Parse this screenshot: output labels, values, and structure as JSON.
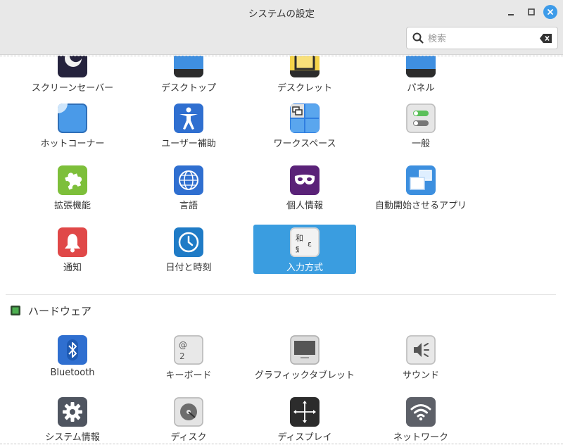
{
  "window": {
    "title": "システムの設定"
  },
  "search": {
    "placeholder": "検索",
    "value": ""
  },
  "sections": [
    {
      "name": "",
      "items": [
        {
          "label": "スクリーンセーバー",
          "icon": "screensaver-icon"
        },
        {
          "label": "デスクトップ",
          "icon": "desktop-icon"
        },
        {
          "label": "デスクレット",
          "icon": "desklet-icon"
        },
        {
          "label": "パネル",
          "icon": "panel-icon"
        },
        {
          "label": "ホットコーナー",
          "icon": "hot-corner-icon"
        },
        {
          "label": "ユーザー補助",
          "icon": "accessibility-icon"
        },
        {
          "label": "ワークスペース",
          "icon": "workspace-icon"
        },
        {
          "label": "一般",
          "icon": "general-toggle-icon"
        },
        {
          "label": "拡張機能",
          "icon": "puzzle-icon"
        },
        {
          "label": "言語",
          "icon": "language-globe-icon"
        },
        {
          "label": "個人情報",
          "icon": "mask-icon"
        },
        {
          "label": "自動開始させるアプリ",
          "icon": "startup-apps-icon"
        },
        {
          "label": "通知",
          "icon": "bell-icon"
        },
        {
          "label": "日付と時刻",
          "icon": "clock-icon"
        },
        {
          "label": "入力方式",
          "icon": "input-method-icon",
          "selected": true
        }
      ]
    },
    {
      "name": "ハードウェア",
      "icon": "chip-icon",
      "items": [
        {
          "label": "Bluetooth",
          "icon": "bluetooth-icon"
        },
        {
          "label": "キーボード",
          "icon": "keyboard-icon"
        },
        {
          "label": "グラフィックタブレット",
          "icon": "tablet-icon"
        },
        {
          "label": "サウンド",
          "icon": "speaker-icon"
        },
        {
          "label": "システム情報",
          "icon": "gear-icon"
        },
        {
          "label": "ディスク",
          "icon": "disk-icon"
        },
        {
          "label": "ディスプレイ",
          "icon": "display-icon"
        },
        {
          "label": "ネットワーク",
          "icon": "wifi-icon"
        }
      ]
    }
  ],
  "colors": {
    "accent": "#3a9de0",
    "titlebar": "#e8e8e8"
  },
  "icon_glyphs": {
    "kanji_top": "和",
    "kanji_bottom": "ฐ",
    "letter_right": "ε",
    "key_top": "@",
    "key_bottom": "2"
  }
}
